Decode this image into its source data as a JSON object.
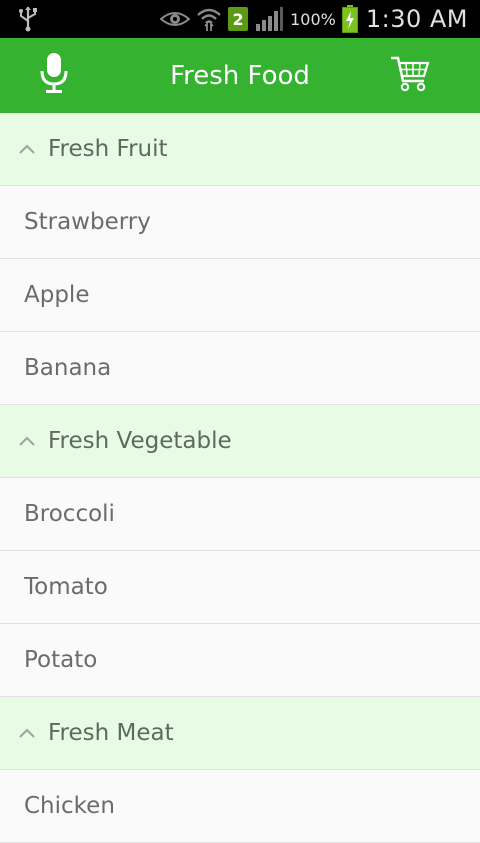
{
  "status_bar": {
    "battery_percent": "100%",
    "time": "1:30 AM",
    "sim_slot": "2"
  },
  "action_bar": {
    "title": "Fresh Food",
    "mic_icon": "microphone-icon",
    "cart_icon": "shopping-cart-icon"
  },
  "groups": [
    {
      "title": "Fresh Fruit",
      "items": [
        "Strawberry",
        "Apple",
        "Banana"
      ]
    },
    {
      "title": "Fresh Vegetable",
      "items": [
        "Broccoli",
        "Tomato",
        "Potato"
      ]
    },
    {
      "title": "Fresh Meat",
      "items": [
        "Chicken"
      ]
    }
  ],
  "colors": {
    "action_bar": "#35b22f",
    "group_header_bg": "#e7fbe5",
    "item_text": "#6b6b6b"
  }
}
